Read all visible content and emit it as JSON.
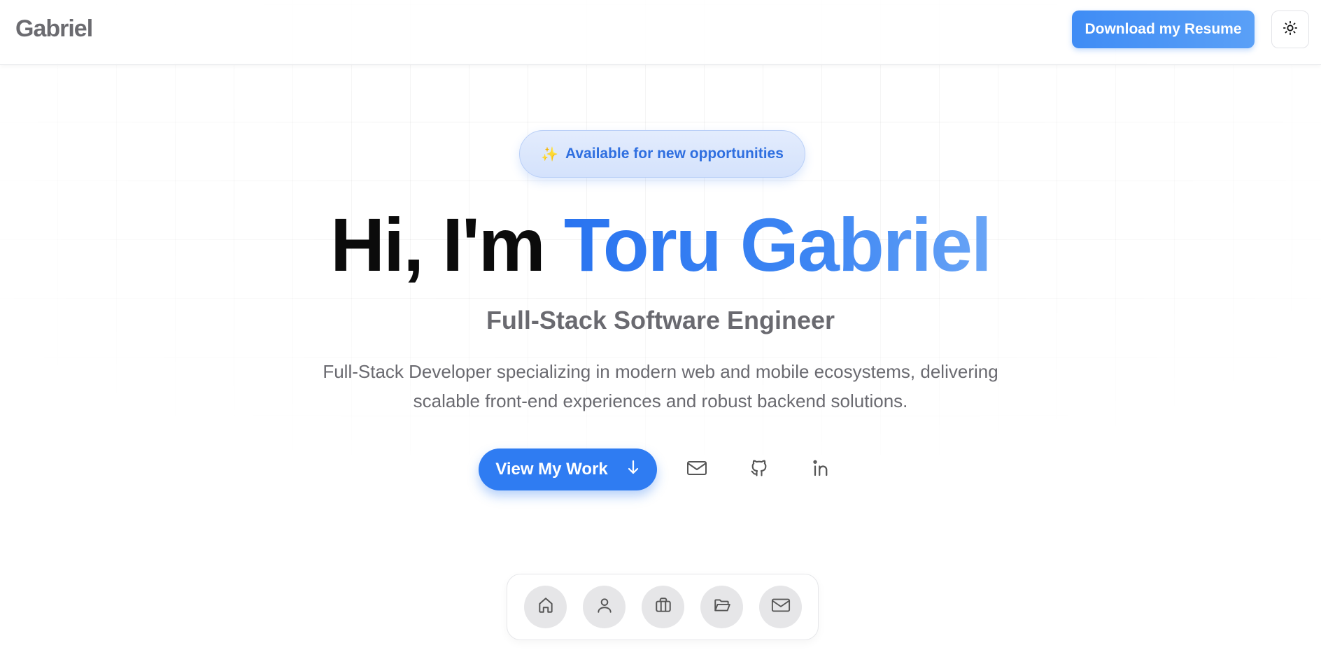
{
  "header": {
    "logo": "Gabriel",
    "resume_label": "Download my Resume",
    "theme_icon": "sun-icon"
  },
  "hero": {
    "badge_icon": "sparkles-icon",
    "badge_text": "Available for new opportunities",
    "greeting": "Hi, I'm",
    "name": "Toru Gabriel",
    "subtitle": "Full-Stack Software Engineer",
    "description": "Full-Stack Developer specializing in modern web and mobile ecosystems, delivering scalable front-end experiences and robust backend solutions."
  },
  "actions": {
    "view_work_label": "View My Work",
    "view_work_icon": "arrow-down-icon",
    "socials": [
      "mail-icon",
      "github-icon",
      "linkedin-icon"
    ]
  },
  "dock": {
    "items": [
      "home-icon",
      "user-icon",
      "briefcase-icon",
      "folder-open-icon",
      "mail-icon"
    ]
  },
  "colors": {
    "accent": "#2f7cf2",
    "badge_text": "#2f6fe0",
    "muted_text": "#6a6a70"
  }
}
